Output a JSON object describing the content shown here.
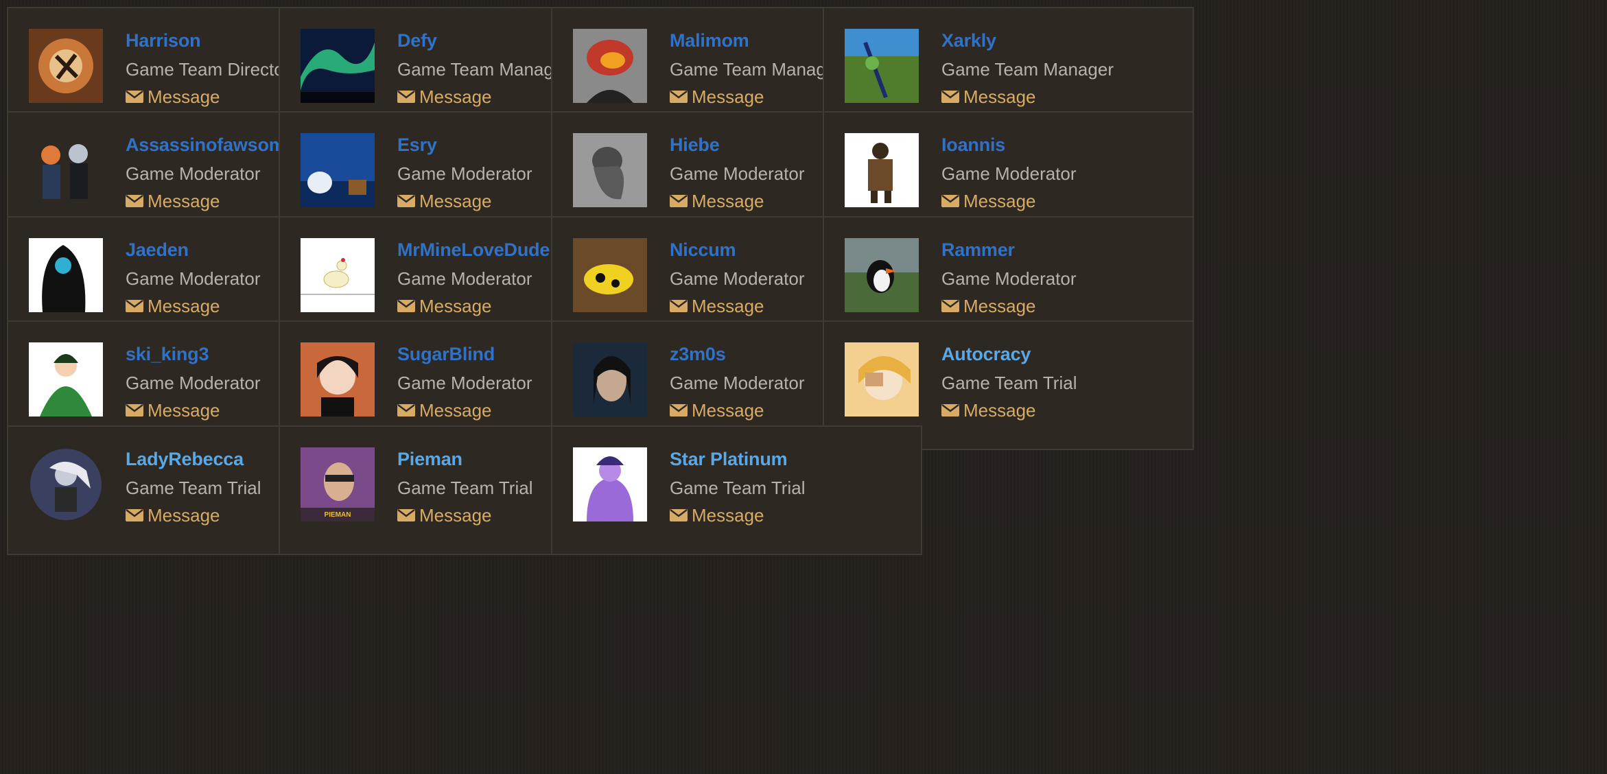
{
  "message_label": "Message",
  "members": [
    {
      "name": "Harrison",
      "role": "Game Team Director",
      "avatar": "avatar-fire-art",
      "style": "dark"
    },
    {
      "name": "Defy",
      "role": "Game Team Manager",
      "avatar": "avatar-aurora",
      "style": "dark"
    },
    {
      "name": "Malimom",
      "role": "Game Team Manager",
      "avatar": "avatar-gloves-portrait",
      "style": "dark"
    },
    {
      "name": "Xarkly",
      "role": "Game Team Manager",
      "avatar": "avatar-green-field",
      "style": "dark"
    },
    {
      "name": "Assassinofawsome",
      "role": "Game Moderator",
      "avatar": "avatar-anime-pair",
      "style": "dark"
    },
    {
      "name": "Esry",
      "role": "Game Moderator",
      "avatar": "avatar-robots-blue",
      "style": "dark"
    },
    {
      "name": "Hiebe",
      "role": "Game Moderator",
      "avatar": "avatar-grey-sketch",
      "style": "dark"
    },
    {
      "name": "Ioannis",
      "role": "Game Moderator",
      "avatar": "avatar-armored-figure",
      "style": "dark"
    },
    {
      "name": "Jaeden",
      "role": "Game Moderator",
      "avatar": "avatar-hooded-figure",
      "style": "dark"
    },
    {
      "name": "MrMineLoveDude",
      "role": "Game Moderator",
      "avatar": "avatar-duck-drawing",
      "style": "dark"
    },
    {
      "name": "Niccum",
      "role": "Game Moderator",
      "avatar": "avatar-yellow-frog",
      "style": "dark"
    },
    {
      "name": "Rammer",
      "role": "Game Moderator",
      "avatar": "avatar-puffin",
      "style": "dark"
    },
    {
      "name": "ski_king3",
      "role": "Game Moderator",
      "avatar": "avatar-green-anime",
      "style": "dark"
    },
    {
      "name": "SugarBlind",
      "role": "Game Moderator",
      "avatar": "avatar-dark-hair-anime",
      "style": "dark"
    },
    {
      "name": "z3m0s",
      "role": "Game Moderator",
      "avatar": "avatar-man-portrait",
      "style": "dark"
    },
    {
      "name": "Autocracy",
      "role": "Game Team Trial",
      "avatar": "avatar-blonde-anime",
      "style": "light"
    },
    {
      "name": "LadyRebecca",
      "role": "Game Team Trial",
      "avatar": "avatar-elf-drawing",
      "style": "light"
    },
    {
      "name": "Pieman",
      "role": "Game Team Trial",
      "avatar": "avatar-pieman-photo",
      "style": "light"
    },
    {
      "name": "Star Platinum",
      "role": "Game Team Trial",
      "avatar": "avatar-purple-fighter",
      "style": "light"
    }
  ]
}
